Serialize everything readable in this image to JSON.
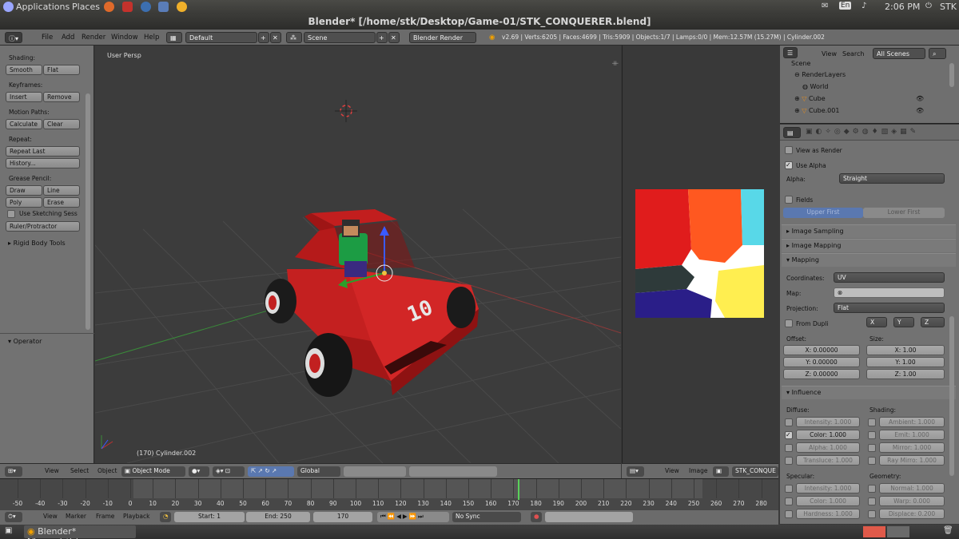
{
  "system_panel": {
    "applications": "Applications",
    "places": "Places",
    "keyboard": "En",
    "clock": "2:06 PM",
    "user": "STK"
  },
  "window": {
    "title": "Blender* [/home/stk/Desktop/Game-01/STK_CONQUERER.blend]"
  },
  "header": {
    "menus": [
      "File",
      "Add",
      "Render",
      "Window",
      "Help"
    ],
    "screen_layout": "Default",
    "scene": "Scene",
    "render_engine": "Blender Render",
    "stats": "v2.69 | Verts:6205 | Faces:4699 | Tris:5909 | Objects:1/7 | Lamps:0/0 | Mem:12.57M (15.27M) | Cylinder.002"
  },
  "tool_panel": {
    "shading_label": "Shading:",
    "smooth": "Smooth",
    "flat": "Flat",
    "keyframes_label": "Keyframes:",
    "insert": "Insert",
    "remove": "Remove",
    "motion_paths_label": "Motion Paths:",
    "calculate": "Calculate",
    "clear": "Clear",
    "repeat_label": "Repeat:",
    "repeat_last": "Repeat Last",
    "history": "History...",
    "grease_pencil_label": "Grease Pencil:",
    "draw": "Draw",
    "line": "Line",
    "poly": "Poly",
    "erase": "Erase",
    "use_sketching": "Use Sketching Sess",
    "ruler": "Ruler/Protractor",
    "rigid_body": "Rigid Body Tools",
    "operator": "Operator"
  },
  "viewport": {
    "view_name": "User Persp",
    "object_info": "(170) Cylinder.002",
    "car_number": "10"
  },
  "viewport_header": {
    "view": "View",
    "select": "Select",
    "object": "Object",
    "mode": "Object Mode",
    "orientation": "Global"
  },
  "image_header": {
    "view": "View",
    "image": "Image",
    "image_name": "STK_CONQUE"
  },
  "outliner": {
    "view": "View",
    "search": "Search",
    "filter": "All Scenes",
    "items": [
      "Scene",
      "RenderLayers",
      "World",
      "Cube",
      "Cube.001"
    ]
  },
  "properties": {
    "view_as_render": "View as Render",
    "use_alpha": "Use Alpha",
    "alpha_label": "Alpha:",
    "alpha_value": "Straight",
    "fields": "Fields",
    "upper_first": "Upper First",
    "lower_first": "Lower First",
    "image_sampling": "Image Sampling",
    "image_mapping": "Image Mapping",
    "mapping": "Mapping",
    "coordinates_label": "Coordinates:",
    "coordinates_value": "UV",
    "map_label": "Map:",
    "projection_label": "Projection:",
    "projection_value": "Flat",
    "from_dupli": "From Dupli",
    "axis_x": "X",
    "axis_y": "Y",
    "axis_z": "Z",
    "offset_label": "Offset:",
    "size_label": "Size:",
    "offset_x": "X: 0.00000",
    "offset_y": "Y: 0.00000",
    "offset_z": "Z: 0.00000",
    "size_x": "X: 1.00",
    "size_y": "Y: 1.00",
    "size_z": "Z: 1.00",
    "influence": "Influence",
    "diffuse_label": "Diffuse:",
    "shading_label": "Shading:",
    "intensity": "Intensity: 1.000",
    "color": "Color: 1.000",
    "alpha": "Alpha: 1.000",
    "translucency": "Transluce: 1.000",
    "ambient": "Ambient: 1.000",
    "emit": "Emit: 1.000",
    "mirror": "Mirror: 1.000",
    "ray_mirror": "Ray Mirro: 1.000",
    "specular_label": "Specular:",
    "geometry_label": "Geometry:",
    "spec_intensity": "Intensity: 1.000",
    "spec_color": "Color: 1.000",
    "hardness": "Hardness: 1.000",
    "normal": "Normal: 1.000",
    "warp": "Warp: 0.000",
    "displace": "Displace: 0.200"
  },
  "timeline": {
    "ticks": [
      "-50",
      "-40",
      "-30",
      "-20",
      "-10",
      "0",
      "10",
      "20",
      "30",
      "40",
      "50",
      "60",
      "70",
      "80",
      "90",
      "100",
      "110",
      "120",
      "130",
      "140",
      "150",
      "160",
      "170",
      "180",
      "190",
      "200",
      "210",
      "220",
      "230",
      "240",
      "250",
      "260",
      "270",
      "280"
    ],
    "current_frame_marker": 170
  },
  "timeline_header": {
    "view": "View",
    "marker": "Marker",
    "frame": "Frame",
    "playback": "Playback",
    "start": "Start: 1",
    "end": "End: 250",
    "current": "170",
    "sync": "No Sync"
  },
  "taskbar": {
    "item": "Blender* [/home/stk/..."
  }
}
